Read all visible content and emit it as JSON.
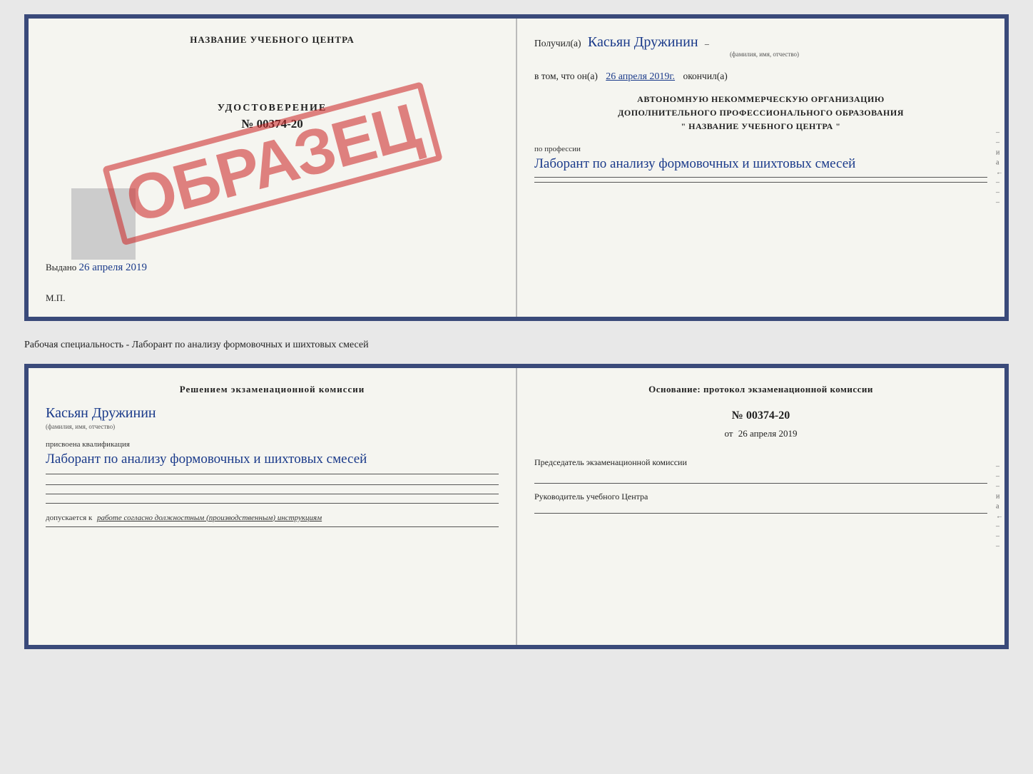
{
  "top_document": {
    "left": {
      "center_title": "НАЗВАНИЕ УЧЕБНОГО ЦЕНТРА",
      "cert_label": "УДОСТОВЕРЕНИЕ",
      "cert_number": "№ 00374-20",
      "issued_text": "Выдано",
      "issued_date": "26 апреля 2019",
      "mp_label": "М.П.",
      "stamp_text": "ОБРАЗЕЦ"
    },
    "right": {
      "received_prefix": "Получил(а)",
      "received_name": "Касьян Дружинин",
      "received_subtext": "(фамилия, имя, отчество)",
      "date_prefix": "в том, что он(а)",
      "date_value": "26 апреля 2019г.",
      "date_suffix": "окончил(а)",
      "org_line1": "АВТОНОМНУЮ НЕКОММЕРЧЕСКУЮ ОРГАНИЗАЦИЮ",
      "org_line2": "ДОПОЛНИТЕЛЬНОГО ПРОФЕССИОНАЛЬНОГО ОБРАЗОВАНИЯ",
      "org_line3": "\"  НАЗВАНИЕ УЧЕБНОГО ЦЕНТРА  \"",
      "profession_label": "по профессии",
      "profession_name": "Лаборант по анализу формовочных и шихтовых смесей",
      "right_letters": [
        "–",
        "–",
        "и",
        "а",
        "←",
        "–",
        "–",
        "–"
      ]
    }
  },
  "specialty_label": "Рабочая специальность - Лаборант по анализу формовочных и шихтовых смесей",
  "bottom_document": {
    "left": {
      "decision_title": "Решением экзаменационной комиссии",
      "person_name": "Касьян Дружинин",
      "name_subtext": "(фамилия, имя, отчество)",
      "qualification_label": "присвоена квалификация",
      "qualification_name": "Лаборант по анализу формовочных и шихтовых смесей",
      "allows_prefix": "допускается к",
      "allows_text": "работе согласно должностным (производственным) инструкциям"
    },
    "right": {
      "basis_title": "Основание: протокол экзаменационной комиссии",
      "protocol_number": "№ 00374-20",
      "protocol_date_prefix": "от",
      "protocol_date": "26 апреля 2019",
      "chairman_label": "Председатель экзаменационной комиссии",
      "director_label": "Руководитель учебного Центра",
      "right_letters": [
        "–",
        "–",
        "–",
        "и",
        "а",
        "←",
        "–",
        "–",
        "–"
      ]
    }
  }
}
